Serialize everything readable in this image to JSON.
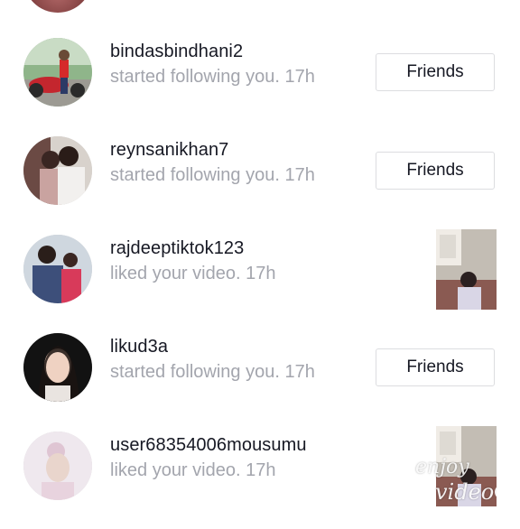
{
  "activity": [
    {
      "username": "bindasbindhani2",
      "action": "started following you.",
      "time": "17h",
      "button_label": "Friends"
    },
    {
      "username": "reynsanikhan7",
      "action": "started following you.",
      "time": "17h",
      "button_label": "Friends"
    },
    {
      "username": "rajdeeptiktok123",
      "action": "liked your video.",
      "time": "17h"
    },
    {
      "username": "likud3a",
      "action": "started following you.",
      "time": "17h",
      "button_label": "Friends"
    },
    {
      "username": "user68354006mousumu",
      "action": "liked your video.",
      "time": "17h"
    }
  ],
  "watermark": {
    "line1": "enjoy",
    "line2": "video"
  }
}
